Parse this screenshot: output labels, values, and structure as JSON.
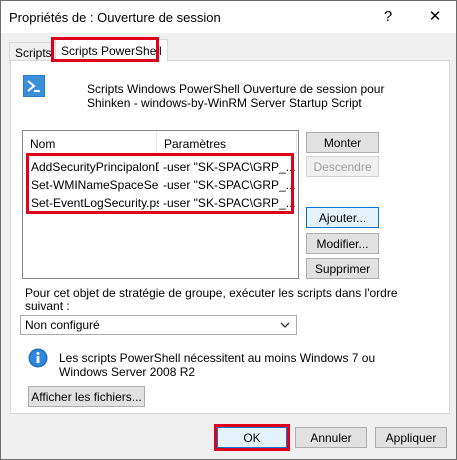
{
  "window": {
    "title": "Propriétés de : Ouverture de session",
    "help_glyph": "?",
    "close_glyph": "✕"
  },
  "tabs": [
    {
      "label": "Scripts"
    },
    {
      "label": "Scripts PowerShell"
    }
  ],
  "header": {
    "icon": "powershell-icon",
    "line1": "Scripts Windows PowerShell Ouverture de session pour",
    "line2": "Shinken - windows-by-WinRM Server Startup Script"
  },
  "list": {
    "columns": [
      "Nom",
      "Paramètres"
    ],
    "rows": [
      {
        "name": "AddSecurityPrincipalonD...",
        "params": "-user \"SK-SPAC\\GRP_..."
      },
      {
        "name": "Set-WMINameSpaceSe...",
        "params": "-user \"SK-SPAC\\GRP_..."
      },
      {
        "name": "Set-EventLogSecurity.ps1",
        "params": "-user \"SK-SPAC\\GRP_..."
      }
    ]
  },
  "side_buttons": {
    "monter": "Monter",
    "descendre": "Descendre",
    "ajouter": "Ajouter...",
    "modifier": "Modifier...",
    "supprimer": "Supprimer"
  },
  "order": {
    "label_line1": "Pour cet objet de stratégie de groupe, exécuter les scripts dans l'ordre",
    "label_line2": "suivant :",
    "selected": "Non configuré"
  },
  "info": {
    "icon": "info-icon",
    "line1": "Les scripts PowerShell nécessitent au moins Windows 7 ou",
    "line2": "Windows Server 2008 R2"
  },
  "show_files_button": "Afficher les fichiers...",
  "footer": {
    "ok": "OK",
    "annuler": "Annuler",
    "appliquer": "Appliquer"
  },
  "colors": {
    "highlight": "#e0001b",
    "focus": "#0078d7"
  }
}
